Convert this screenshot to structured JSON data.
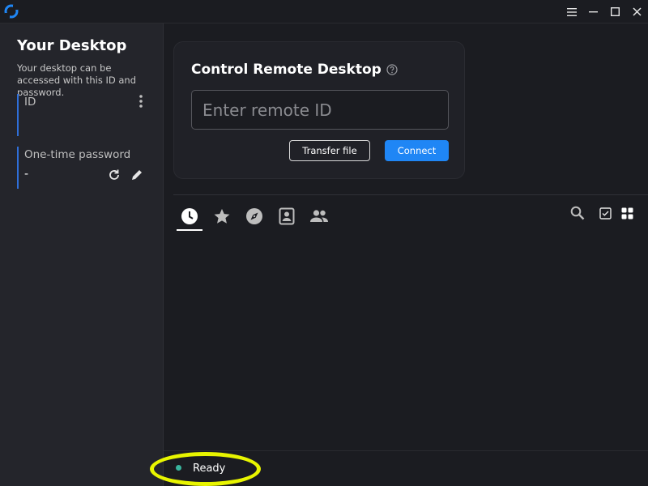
{
  "titlebar": {
    "icons": [
      "app-logo-icon",
      "menu-icon",
      "minimize-icon",
      "maximize-icon",
      "close-icon"
    ]
  },
  "sidebar": {
    "title": "Your Desktop",
    "description": "Your desktop can be accessed with this ID and password.",
    "id_label": "ID",
    "id_value": "",
    "password_label": "One-time password",
    "password_value": "-"
  },
  "connect": {
    "title": "Control Remote Desktop",
    "input_placeholder": "Enter remote ID",
    "input_value": "",
    "transfer_label": "Transfer file",
    "connect_label": "Connect"
  },
  "tabs": [
    {
      "icon": "clock-icon",
      "active": true
    },
    {
      "icon": "star-icon",
      "active": false
    },
    {
      "icon": "compass-icon",
      "active": false
    },
    {
      "icon": "address-book-icon",
      "active": false
    },
    {
      "icon": "group-icon",
      "active": false
    }
  ],
  "status": {
    "text": "Ready",
    "dot_color": "#39b59e"
  },
  "colors": {
    "accent": "#1f86f5",
    "highlight": "#e8f500",
    "sidebar_bar": "#2f6fd9"
  }
}
